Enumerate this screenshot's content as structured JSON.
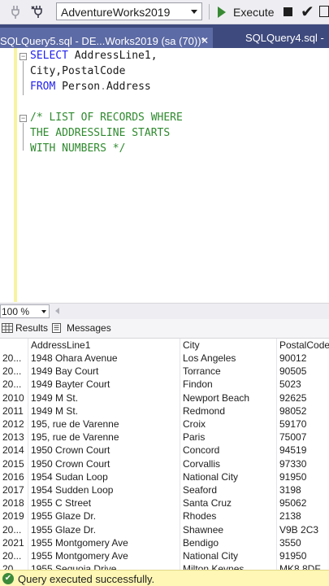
{
  "toolbar": {
    "database": "AdventureWorks2019",
    "execute_label": "Execute"
  },
  "tabs": {
    "active": "SQLQuery5.sql - DE...Works2019 (sa (70))*",
    "active_close": "✕",
    "other": "SQLQuery4.sql -"
  },
  "editor": {
    "l1_kw": "SELECT",
    "l1_rest": " AddressLine1,",
    "l2": "City,PostalCode",
    "l3_kw": "FROM",
    "l3_rest": " Person",
    "l3_dot": ".",
    "l3_obj": "Address",
    "c1": "/* LIST OF RECORDS WHERE",
    "c2": "THE ADDRESSLINE STARTS",
    "c3": "WITH NUMBERS */"
  },
  "zoom": "100 %",
  "results_tabs": {
    "results": "Results",
    "messages": "Messages"
  },
  "grid": {
    "columns": [
      "",
      "AddressLine1",
      "City",
      "PostalCode"
    ],
    "rows": [
      [
        "20...",
        "1948 Ohara Avenue",
        "Los Angeles",
        "90012"
      ],
      [
        "20...",
        "1949 Bay Court",
        "Torrance",
        "90505"
      ],
      [
        "20...",
        "1949 Bayter Court",
        "Findon",
        "5023"
      ],
      [
        "2010",
        "1949 M St.",
        "Newport Beach",
        "92625"
      ],
      [
        "2011",
        "1949 M St.",
        "Redmond",
        "98052"
      ],
      [
        "2012",
        "195, rue de Varenne",
        "Croix",
        "59170"
      ],
      [
        "2013",
        "195, rue de Varenne",
        "Paris",
        "75007"
      ],
      [
        "2014",
        "1950 Crown Court",
        "Concord",
        "94519"
      ],
      [
        "2015",
        "1950 Crown Court",
        "Corvallis",
        "97330"
      ],
      [
        "2016",
        "1954 Sudan Loop",
        "National City",
        "91950"
      ],
      [
        "2017",
        "1954 Sudden Loop",
        "Seaford",
        "3198"
      ],
      [
        "2018",
        "1955 C Street",
        "Santa Cruz",
        "95062"
      ],
      [
        "2019",
        "1955 Glaze Dr.",
        "Rhodes",
        "2138"
      ],
      [
        "20...",
        "1955 Glaze Dr.",
        "Shawnee",
        "V9B 2C3"
      ],
      [
        "2021",
        "1955 Montgomery Ave",
        "Bendigo",
        "3550"
      ],
      [
        "20...",
        "1955 Montgomery Ave",
        "National City",
        "91950"
      ],
      [
        "20...",
        "1955 Sequoia Drive",
        "Milton Keynes",
        "MK8 8DF"
      ]
    ]
  },
  "status": {
    "text": "Query executed successfully."
  },
  "colors": {
    "tab_bar": "#3e4a7d",
    "tab_active": "#5c6aa5",
    "keyword": "#2222ee",
    "comment": "#2f8a2f",
    "status_bg": "#fff7b5"
  }
}
